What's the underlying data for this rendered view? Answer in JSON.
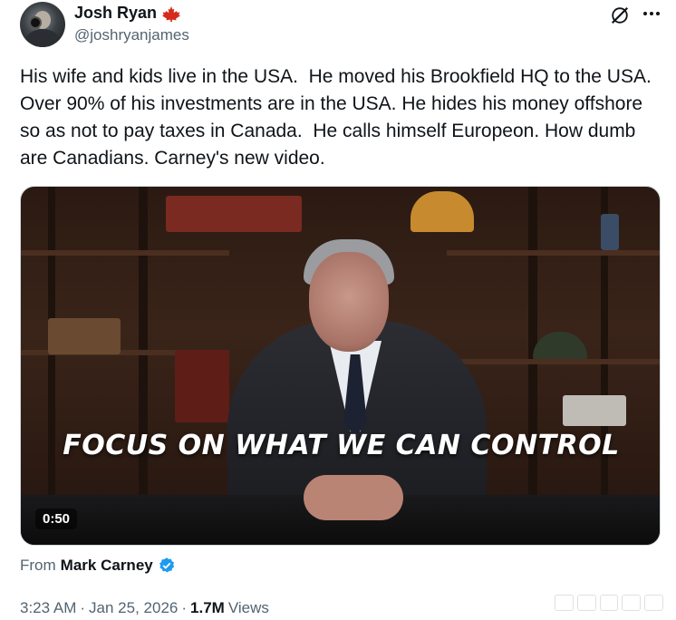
{
  "author": {
    "name": "Josh Ryan",
    "handle": "@joshryanjames",
    "flag_icon": "canada-flag-icon",
    "flag_color": "#d52b1e"
  },
  "actions": {
    "grok_icon": "grok-icon",
    "more_icon": "more-icon"
  },
  "tweet": {
    "text": "His wife and kids live in the USA.  He moved his Brookfield HQ to the USA. Over 90% of his investments are in the USA. He hides his money offshore so as not to pay taxes in Canada.  He calls himself Europeon. How dumb are Canadians. Carney's new video."
  },
  "video": {
    "overlay_text": "FOCUS ON WHAT WE CAN CONTROL",
    "duration": "0:50"
  },
  "attribution": {
    "from_label": "From",
    "from_name": "Mark Carney",
    "verified_color": "#1d9bf0"
  },
  "meta": {
    "time": "3:23 AM",
    "separator": "·",
    "date": "Jan 25, 2026",
    "views_count": "1.7M",
    "views_label": "Views"
  }
}
